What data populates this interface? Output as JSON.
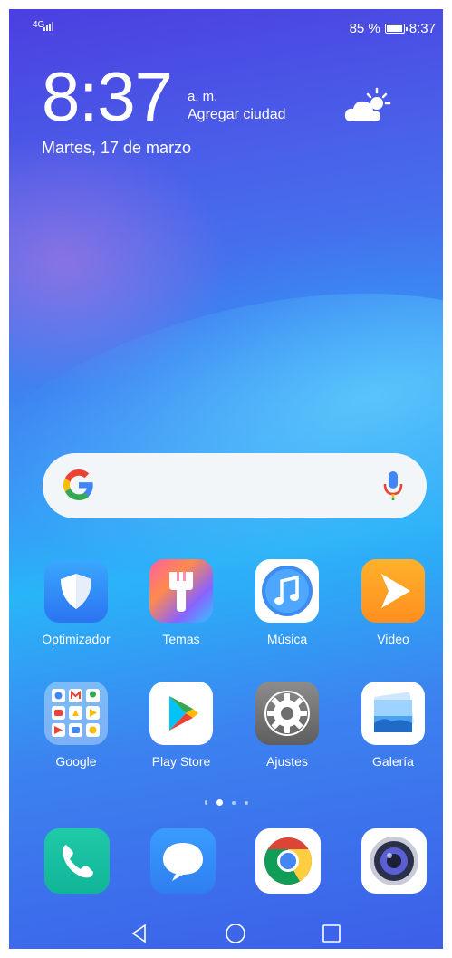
{
  "status_bar": {
    "network": "4G",
    "battery_percent": "85 %",
    "time": "8:37",
    "battery_level": 0.85
  },
  "lock_clock": {
    "time": "8:37",
    "ampm": "a. m.",
    "add_city": "Agregar ciudad",
    "date": "Martes, 17 de marzo"
  },
  "weather": {
    "icon": "partly-sunny-icon"
  },
  "search": {
    "logo": "google-g-icon",
    "mic": "mic-icon"
  },
  "apps_row1": [
    {
      "label": "Optimizador",
      "icon": "shield-icon"
    },
    {
      "label": "Temas",
      "icon": "paint-brush-icon"
    },
    {
      "label": "Música",
      "icon": "music-note-icon"
    },
    {
      "label": "Video",
      "icon": "play-icon"
    }
  ],
  "apps_row2": [
    {
      "label": "Google",
      "icon": "folder-icon"
    },
    {
      "label": "Play Store",
      "icon": "play-store-icon"
    },
    {
      "label": "Ajustes",
      "icon": "gear-icon"
    },
    {
      "label": "Galería",
      "icon": "gallery-icon"
    }
  ],
  "page_indicator": {
    "count": 4,
    "active": 1
  },
  "dock": [
    {
      "icon": "phone-icon"
    },
    {
      "icon": "chat-icon"
    },
    {
      "icon": "chrome-icon"
    },
    {
      "icon": "camera-icon"
    }
  ],
  "nav_bar": {
    "back": "back-icon",
    "home": "home-icon",
    "recents": "recents-icon"
  },
  "colors": {
    "accent_blue": "#4285F4",
    "red": "#EA4335",
    "yellow": "#FBBC05",
    "green": "#34A853"
  }
}
